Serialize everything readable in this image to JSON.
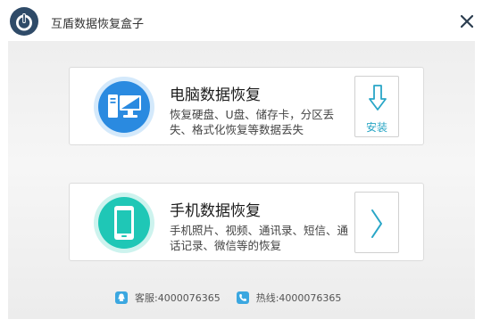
{
  "app": {
    "title": "互盾数据恢复盒子",
    "logo_icon": "power-shield-icon",
    "close_icon": "close-icon"
  },
  "cards": [
    {
      "title": "电脑数据恢复",
      "description": "恢复硬盘、U盘、储存卡，分区丢失、格式化恢复等数据丢失",
      "icon": "computer-icon",
      "action_icon": "download-arrow-icon",
      "action_label": "安装"
    },
    {
      "title": "手机数据恢复",
      "description": "手机照片、视频、通讯录、短信、通话记录、微信等的恢复",
      "icon": "phone-icon",
      "action_icon": "chevron-right-icon",
      "action_label": ""
    }
  ],
  "footer": {
    "service_text": "客服:4000076365",
    "hotline_text": "热线:4000076365",
    "service_icon": "qq-icon",
    "hotline_icon": "phone-handset-icon"
  },
  "colors": {
    "logo": "#2f4b68",
    "computer_accent": "#2a8ae0",
    "phone_accent": "#1fc7b6",
    "install_text": "#27a5c4"
  }
}
